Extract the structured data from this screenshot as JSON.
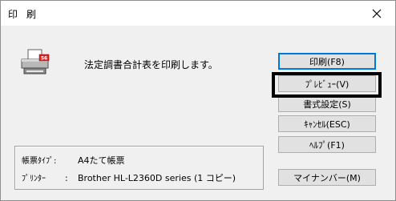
{
  "window": {
    "title": "印刷"
  },
  "icons": {
    "close": "close-icon",
    "printer": "printer-icon"
  },
  "message": "法定調書合計表を印刷します。",
  "info": {
    "form_type_label": "帳票ﾀｲﾌﾟ:",
    "form_type_value": "A4たて帳票",
    "printer_label": "ﾌﾟﾘﾝﾀｰ",
    "printer_sep": ":",
    "printer_value": "Brother HL-L2360D series (1 コピー)"
  },
  "buttons": {
    "print": "印刷(F8)",
    "preview": "ﾌﾟﾚﾋﾞｭｰ(V)",
    "format_settings": "書式設定(S)",
    "cancel": "ｷｬﾝｾﾙ(ESC)",
    "help": "ﾍﾙﾌﾟ(F1)",
    "my_number": "マイナンバー(M)"
  },
  "colors": {
    "accent": "#0078d7",
    "printer_badge": "#e02020"
  }
}
